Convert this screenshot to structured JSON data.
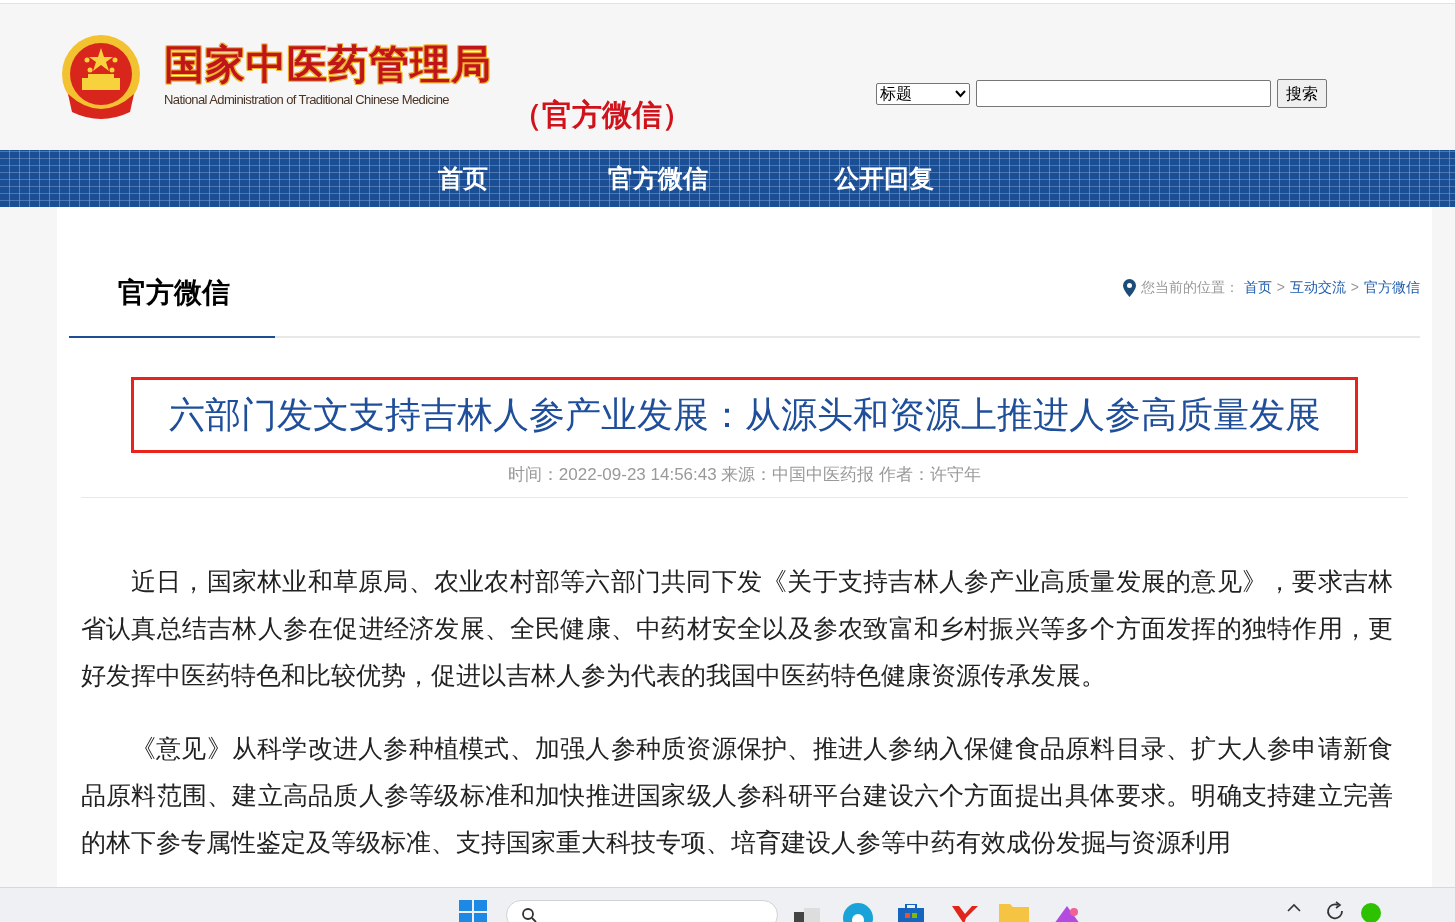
{
  "header": {
    "agency_name": "国家中医药管理局",
    "agency_name_en": "National Administration of Traditional Chinese Medicine",
    "subtitle": "（官方微信）"
  },
  "search": {
    "scope": "标题",
    "button": "搜索"
  },
  "nav": [
    {
      "label": "首页"
    },
    {
      "label": "官方微信"
    },
    {
      "label": "公开回复"
    }
  ],
  "section_title": "官方微信",
  "breadcrumb": {
    "prefix": "您当前的位置：",
    "items": [
      "首页",
      "互动交流",
      "官方微信"
    ],
    "separators": [
      ">",
      ">"
    ]
  },
  "article": {
    "title": "六部门发文支持吉林人参产业发展：从源头和资源上推进人参高质量发展",
    "meta": "时间：2022-09-23 14:56:43 来源：中国中医药报 作者：许守年",
    "paragraphs": [
      "近日，国家林业和草原局、农业农村部等六部门共同下发《关于支持吉林人参产业高质量发展的意见》，要求吉林省认真总结吉林人参在促进经济发展、全民健康、中药材安全以及参农致富和乡村振兴等多个方面发挥的独特作用，更好发挥中医药特色和比较优势，促进以吉林人参为代表的我国中医药特色健康资源传承发展。",
      "《意见》从科学改进人参种植模式、加强人参种质资源保护、推进人参纳入保健食品原料目录、扩大人参申请新食品原料范围、建立高品质人参等级标准和加快推进国家级人参科研平台建设六个方面提出具体要求。明确支持建立完善的林下参专属性鉴定及等级标准、支持国家重大科技专项、培育建设人参等中药有效成份发掘与资源利用"
    ]
  }
}
